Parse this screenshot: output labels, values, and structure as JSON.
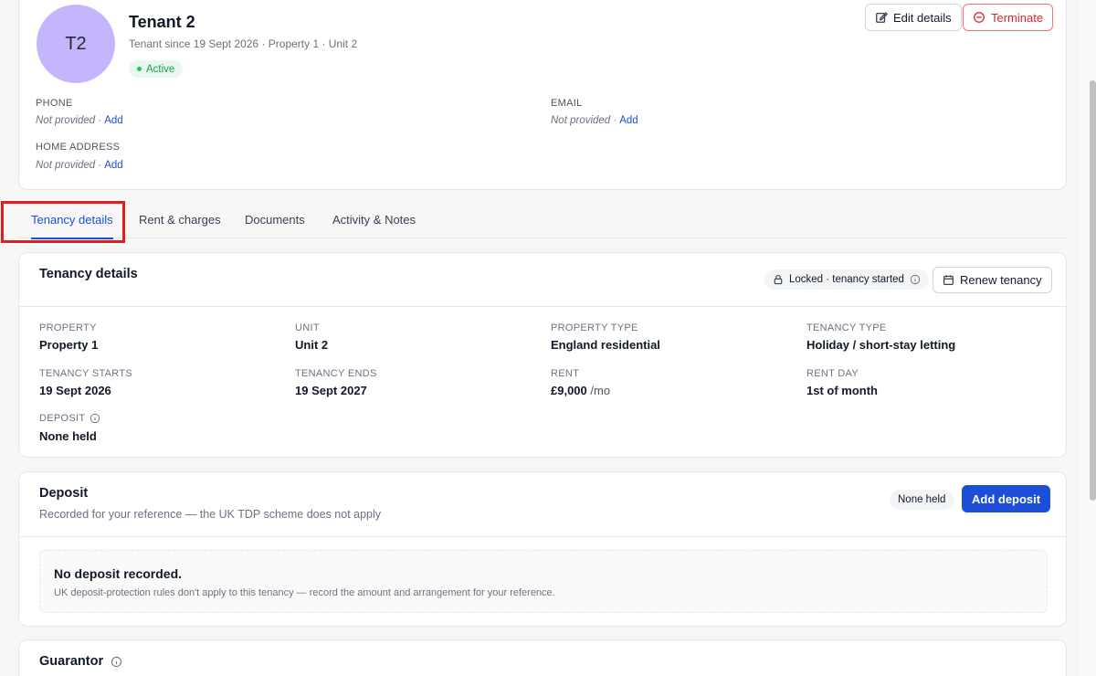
{
  "header": {
    "avatar_initials": "T2",
    "tenant_name": "Tenant 2",
    "tenant_meta": "Tenant since 19 Sept 2026 · Property 1 · Unit 2",
    "status": "Active",
    "edit_label": "Edit details",
    "terminate_label": "Terminate",
    "phone_label": "PHONE",
    "phone_value": "Not provided ·",
    "email_label": "EMAIL",
    "email_value": "Not provided ·",
    "address_label": "HOME ADDRESS",
    "address_value": "Not provided ·",
    "add_label": "Add"
  },
  "tabs": [
    {
      "label": "Tenancy details",
      "active": true
    },
    {
      "label": "Rent & charges",
      "active": false
    },
    {
      "label": "Documents",
      "active": false
    },
    {
      "label": "Activity & Notes",
      "active": false
    }
  ],
  "tenancy": {
    "title": "Tenancy details",
    "lock_label": "Locked · tenancy started",
    "renew_label": "Renew tenancy",
    "fields": [
      {
        "label": "PROPERTY",
        "value": "Property 1"
      },
      {
        "label": "UNIT",
        "value": "Unit 2"
      },
      {
        "label": "PROPERTY TYPE",
        "value": "England residential"
      },
      {
        "label": "TENANCY TYPE",
        "value": "Holiday / short-stay letting"
      },
      {
        "label": "TENANCY STARTS",
        "value": "19 Sept 2026"
      },
      {
        "label": "TENANCY ENDS",
        "value": "19 Sept 2027"
      },
      {
        "label": "RENT",
        "value": "£9,000",
        "unit": "/mo"
      },
      {
        "label": "RENT DAY",
        "value": "1st of month"
      },
      {
        "label": "DEPOSIT",
        "value": "None held"
      }
    ]
  },
  "deposit": {
    "title": "Deposit",
    "subtitle": "Recorded for your reference — the UK TDP scheme does not apply",
    "status": "None held",
    "add_label": "Add deposit",
    "empty_title": "No deposit recorded.",
    "empty_subtitle": "UK deposit-protection rules don't apply to this tenancy — record the amount and arrangement for your reference."
  },
  "guarantor": {
    "title": "Guarantor"
  },
  "colors": {
    "accent": "#1d4ed8",
    "avatar": "#c4b5fd",
    "danger": "#dc2626",
    "success": "#16a34a",
    "highlight": "#e11d1d"
  },
  "icons": [
    "edit-icon",
    "minus-circle-icon",
    "lock-icon",
    "info-icon",
    "calendar-icon"
  ]
}
